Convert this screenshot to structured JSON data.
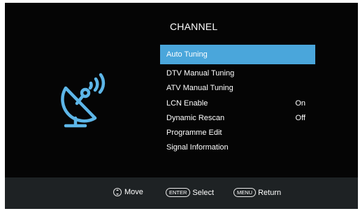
{
  "header": {
    "title": "CHANNEL"
  },
  "menu": {
    "items": [
      {
        "label": "Auto Tuning",
        "value": "",
        "selected": true
      },
      {
        "label": "DTV Manual Tuning",
        "value": ""
      },
      {
        "label": "ATV Manual Tuning",
        "value": ""
      },
      {
        "label": "LCN Enable",
        "value": "On"
      },
      {
        "label": "Dynamic Rescan",
        "value": "Off"
      },
      {
        "label": "Programme Edit",
        "value": ""
      },
      {
        "label": "Signal Information",
        "value": ""
      }
    ]
  },
  "footer": {
    "move_label": "Move",
    "enter_key": "ENTER",
    "select_label": "Select",
    "menu_key": "MENU",
    "return_label": "Return"
  },
  "icons": {
    "channel": "satellite-dish-icon",
    "move": "up-down-arrows-icon"
  },
  "colors": {
    "selected": "#4aa6db",
    "background": "#050505",
    "footer": "#1e2224"
  }
}
